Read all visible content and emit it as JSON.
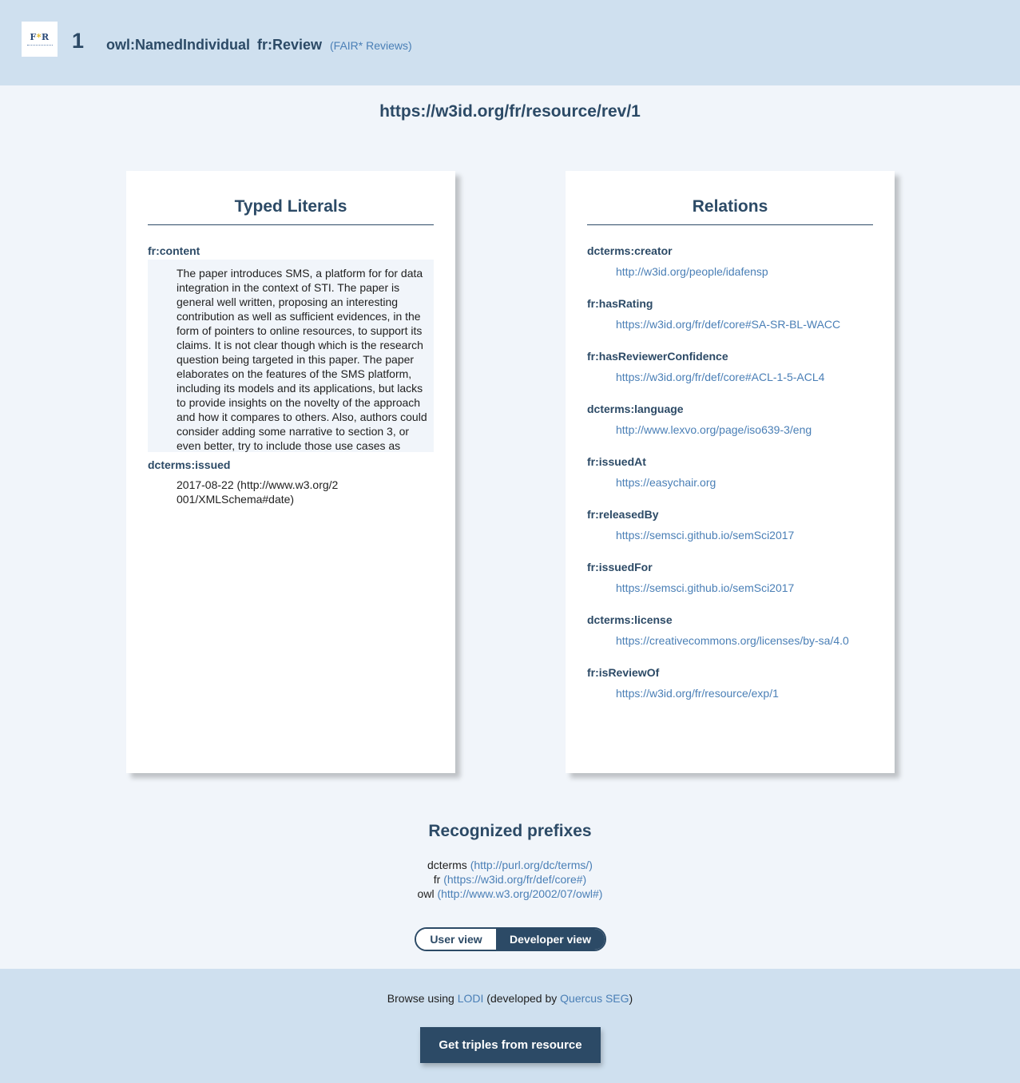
{
  "header": {
    "logo_text": "F*R",
    "number": "1",
    "types": [
      "owl:NamedIndividual",
      "fr:Review"
    ],
    "source": "(FAIR* Reviews)"
  },
  "resource_uri": "https://w3id.org/fr/resource/rev/1",
  "typed_literals": {
    "title": "Typed Literals",
    "content_label": "fr:content",
    "content_value": "The paper introduces SMS, a platform for for data integration in the context of STI. The paper is general well written, proposing an interesting contribution as well as sufficient evidences, in the form of pointers to online resources, to support its claims. It is not clear though which is the research question being targeted in this paper. The paper elaborates on the features of the SMS platform, including its models and its applications, but lacks to provide insights on the novelty of the approach and how it compares to others. Also, authors could consider adding some narrative to section 3, or even better, try to include those use cases as",
    "issued_label": "dcterms:issued",
    "issued_value": "2017-08-22 (http://www.w3.org/2001/XMLSchema#date)"
  },
  "relations": {
    "title": "Relations",
    "items": [
      {
        "property": "dcterms:creator",
        "value": "http://w3id.org/people/idafensp"
      },
      {
        "property": "fr:hasRating",
        "value": "https://w3id.org/fr/def/core#SA-SR-BL-WACC"
      },
      {
        "property": "fr:hasReviewerConfidence",
        "value": "https://w3id.org/fr/def/core#ACL-1-5-ACL4"
      },
      {
        "property": "dcterms:language",
        "value": "http://www.lexvo.org/page/iso639-3/eng"
      },
      {
        "property": "fr:issuedAt",
        "value": "https://easychair.org"
      },
      {
        "property": "fr:releasedBy",
        "value": "https://semsci.github.io/semSci2017"
      },
      {
        "property": "fr:issuedFor",
        "value": "https://semsci.github.io/semSci2017"
      },
      {
        "property": "dcterms:license",
        "value": "https://creativecommons.org/licenses/by-sa/4.0"
      },
      {
        "property": "fr:isReviewOf",
        "value": "https://w3id.org/fr/resource/exp/1"
      }
    ]
  },
  "prefixes": {
    "title": "Recognized prefixes",
    "items": [
      {
        "prefix": "dcterms",
        "uri": "(http://purl.org/dc/terms/)"
      },
      {
        "prefix": "fr",
        "uri": "(https://w3id.org/fr/def/core#)"
      },
      {
        "prefix": "owl",
        "uri": "(http://www.w3.org/2002/07/owl#)"
      }
    ]
  },
  "view_toggle": {
    "user_label": "User view",
    "developer_label": "Developer view",
    "selected": "Developer view"
  },
  "footer": {
    "browse_prefix": "Browse using ",
    "lodi_link": "LODI",
    "developed_by": " (developed by ",
    "quercus_link": "Quercus SEG",
    "closing": ")",
    "button_label": "Get triples from resource"
  }
}
